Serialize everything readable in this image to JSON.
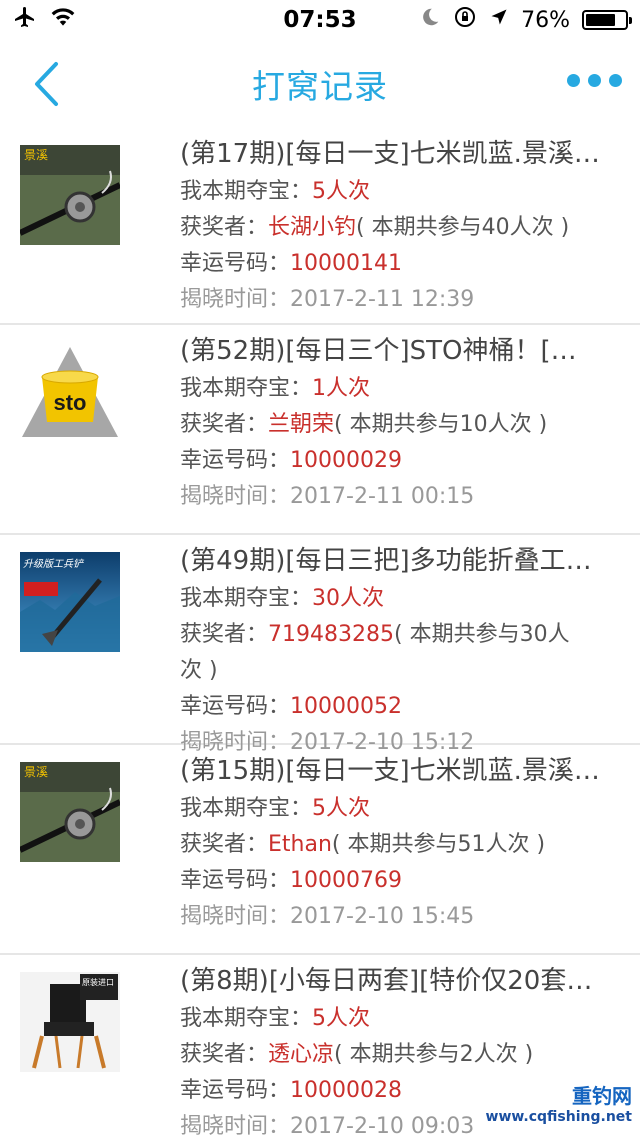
{
  "status": {
    "time": "07:53",
    "battery": "76%"
  },
  "nav": {
    "title": "打窝记录"
  },
  "labels": {
    "my_bets": "我本期夺宝：",
    "winner": "获奖者：",
    "lucky_number": "幸运号码：",
    "reveal_time": "揭晓时间："
  },
  "records": [
    {
      "title": "(第17期)[每日一支]七米凯蓝.景溪…",
      "my_count": "5人次",
      "winner": "长湖小钓",
      "participants": "( 本期共参与40人次 )",
      "lucky_number": "10000141",
      "reveal_time": "2017-2-11 12:39"
    },
    {
      "title": "(第52期)[每日三个]STO神桶！[…",
      "my_count": "1人次",
      "winner": "兰朝荣",
      "participants": "( 本期共参与10人次 )",
      "lucky_number": "10000029",
      "reveal_time": "2017-2-11 00:15"
    },
    {
      "title": "(第49期)[每日三把]多功能折叠工…",
      "my_count": "30人次",
      "winner": "719483285",
      "participants": "( 本期共参与30人",
      "participants_cont": "次 )",
      "lucky_number": "10000052",
      "reveal_time": "2017-2-10 15:12"
    },
    {
      "title": "(第15期)[每日一支]七米凯蓝.景溪…",
      "my_count": "5人次",
      "winner": "Ethan",
      "participants": "( 本期共参与51人次 )",
      "lucky_number": "10000769",
      "reveal_time": "2017-2-10 15:45"
    },
    {
      "title": "(第8期)[小每日两套][特价仅20套…",
      "my_count": "5人次",
      "winner": "透心凉",
      "participants": "( 本期共参与2人次 )",
      "lucky_number": "10000028",
      "reveal_time": "2017-2-10 09:03"
    }
  ],
  "thumbs": {
    "rod_brand": "景溪",
    "bucket_brand": "sto",
    "shovel_brand": "升级版工兵铲",
    "chair_brand": "原装进口"
  },
  "watermark": {
    "brand": "重钓网",
    "url": "www.cqfishing.net"
  }
}
